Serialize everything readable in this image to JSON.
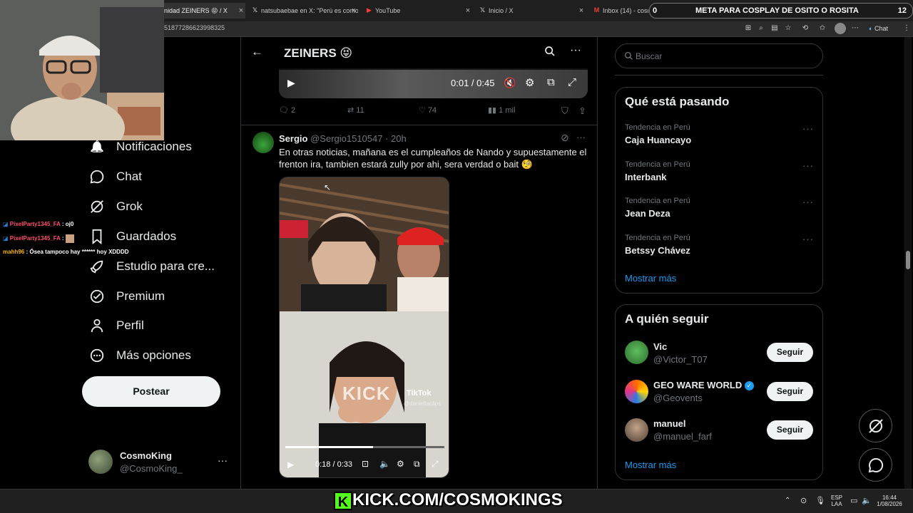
{
  "browser": {
    "tabs": [
      {
        "title": "nidad ZEINERS 😝 / X",
        "active": true
      },
      {
        "title": "natsubaebae en X: \"Perú es como",
        "active": false
      },
      {
        "title": "YouTube",
        "active": false
      },
      {
        "title": "Inicio / X",
        "active": false
      },
      {
        "title": "Inbox (14) - cosmo",
        "active": false
      }
    ],
    "url": "51877286623998325",
    "chat_label": "Chat"
  },
  "stream_overlay": {
    "title_prefix": "0",
    "title": "META PARA COSPLAY DE OSITO O ROSITA",
    "count": "12",
    "banner": "KICK.COM/COSMOKINGS",
    "chat": [
      {
        "user": "PixelParty1345_FA",
        "message": ": oj0",
        "color": "#ff4d6d"
      },
      {
        "user": "PixelParty1345_FA",
        "message": ":",
        "color": "#ff4d6d"
      },
      {
        "user": "mahh96",
        "message": ": Ósea tampoco hay ****** hoy XDDDD",
        "color": "#f5b400"
      }
    ]
  },
  "sidebar": {
    "items": [
      {
        "label": "Notificaciones",
        "icon": "bell-icon",
        "glyph": "🔔"
      },
      {
        "label": "Chat",
        "icon": "chat-icon",
        "glyph": "💬"
      },
      {
        "label": "Grok",
        "icon": "grok-icon",
        "glyph": "⊘"
      },
      {
        "label": "Guardados",
        "icon": "bookmark-icon",
        "glyph": "🔖"
      },
      {
        "label": "Estudio para cre...",
        "icon": "rocket-icon",
        "glyph": "🚀"
      },
      {
        "label": "Premium",
        "icon": "verified-icon",
        "glyph": "✪"
      },
      {
        "label": "Perfil",
        "icon": "profile-icon",
        "glyph": "👤"
      },
      {
        "label": "Más opciones",
        "icon": "more-options-icon",
        "glyph": "⋯"
      }
    ],
    "post_button": "Postear",
    "account": {
      "name": "CosmoKing",
      "handle": "@CosmoKing_"
    }
  },
  "main": {
    "header_title": "ZEINERS 😝",
    "top_video": {
      "time": "0:01 / 0:45"
    },
    "top_actions": {
      "replies": "2",
      "reposts": "11",
      "likes": "74",
      "views": "1 mil"
    },
    "tweet": {
      "author": "Sergio",
      "handle": "@Sergio1510547",
      "time": "· 20h",
      "text": "En otras noticias, mañana es el cumpleaños de Nando y supuestamente el frenton ira, tambien estará zully por ahi, sera verdad o bait 🧐",
      "video_time": "0:18 / 0:33",
      "watermark": "KICK",
      "tiktok_label": "TikTok",
      "tiktok_handle": "@danieltaclips"
    }
  },
  "right": {
    "search_placeholder": "Buscar",
    "trends_title": "Qué está pasando",
    "trends": [
      {
        "category": "Tendencia en Perú",
        "name": "Caja Huancayo"
      },
      {
        "category": "Tendencia en Perú",
        "name": "Interbank"
      },
      {
        "category": "Tendencia en Perú",
        "name": "Jean Deza"
      },
      {
        "category": "Tendencia en Perú",
        "name": "Betssy Chávez"
      }
    ],
    "trends_more": "Mostrar más",
    "follow_title": "A quién seguir",
    "follow": [
      {
        "name": "Vic",
        "handle": "@Victor_T07",
        "button": "Seguir",
        "verified": false
      },
      {
        "name": "GEO WARE WORLD",
        "handle": "@Geovents",
        "button": "Seguir",
        "verified": true
      },
      {
        "name": "manuel",
        "handle": "@manuel_farf",
        "button": "Seguir",
        "verified": false
      }
    ],
    "follow_more": "Mostrar más"
  },
  "taskbar": {
    "lang": "ESP",
    "lang_sub": "LAA",
    "time": "16:44",
    "date": "1/08/2026"
  },
  "colors": {
    "accent": "#1d9bf0",
    "kick_green": "#53fc18",
    "background": "#000000"
  }
}
